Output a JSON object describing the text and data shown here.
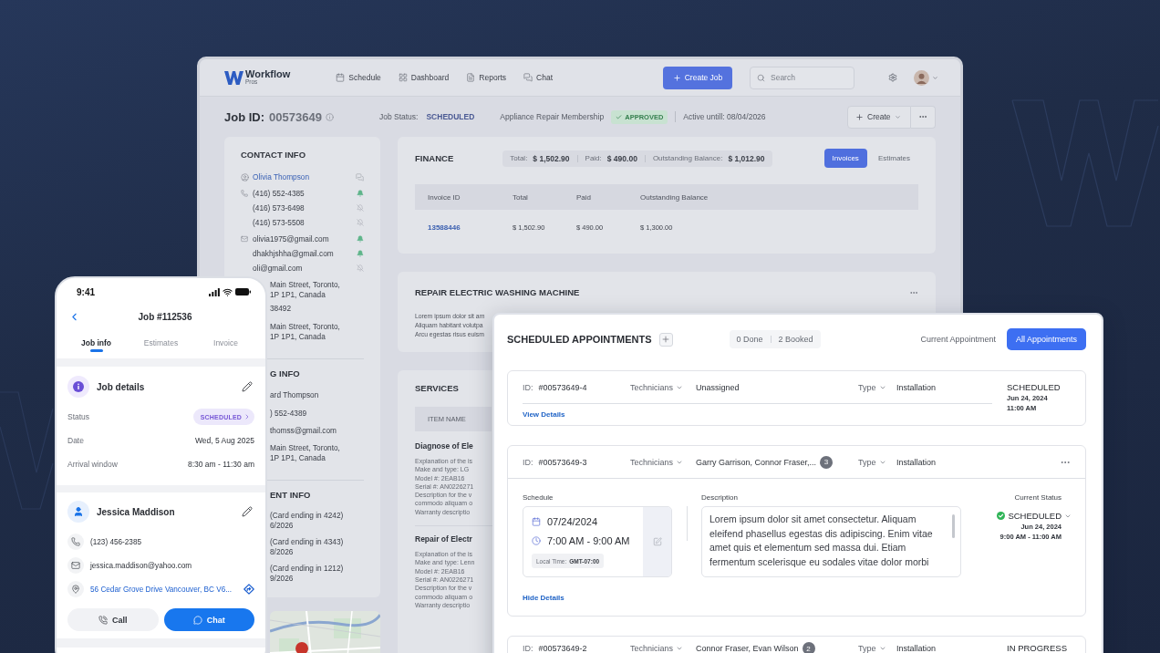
{
  "back_window": {
    "header": {
      "logo": {
        "name": "Workflow",
        "tagline": "Pros"
      },
      "nav": [
        {
          "label": "Schedule"
        },
        {
          "label": "Dashboard"
        },
        {
          "label": "Reports"
        },
        {
          "label": "Chat"
        }
      ],
      "create_button": "Create Job",
      "search": {
        "placeholder": "Search"
      }
    },
    "job_bar": {
      "id_label": "Job ID:",
      "id": "00573649",
      "status_label": "Job Status:",
      "status": "SCHEDULED",
      "membership": "Appliance Repair Membership",
      "badge": "APPROVED",
      "active_until": "Active untill: 08/04/2026",
      "create_menu": "Create"
    },
    "contact_info": {
      "title": "CONTACT INFO",
      "name": "Olivia Thompson",
      "phones": [
        {
          "value": "(416) 552-4385",
          "notify": true
        },
        {
          "value": "(416) 573-6498",
          "notify": false
        },
        {
          "value": "(416) 573-5508",
          "notify": false
        }
      ],
      "emails": [
        {
          "value": "olivia1975@gmail.com",
          "notify": true
        },
        {
          "value": "dhakhjshha@gmail.com",
          "notify": true
        },
        {
          "value": "oli@gmail.com",
          "notify": false
        }
      ],
      "partly_covered": [
        [
          "Main Street, Toronto,",
          "1P 1P1, Canada"
        ],
        [
          "38492"
        ],
        [
          "Main Street, Toronto,",
          "1P 1P1, Canada"
        ]
      ]
    },
    "billing_info": {
      "title": "G INFO",
      "partly_covered": [
        [
          "ard Thompson"
        ],
        [
          ") 552-4389"
        ],
        [
          "thomss@gmail.com"
        ],
        [
          "Main Street, Toronto,",
          "1P 1P1, Canada"
        ]
      ]
    },
    "payment_info": {
      "title": "ENT INFO",
      "partly_covered": [
        [
          "(Card ending in 4242)",
          "6/2026"
        ],
        [
          "(Card ending in 4343)",
          "8/2026"
        ],
        [
          "(Card ending in 1212)",
          "9/2026"
        ]
      ]
    },
    "finance": {
      "title": "FINANCE",
      "summary": [
        {
          "label": "Total:",
          "value": "$ 1,502.90"
        },
        {
          "label": "Paid:",
          "value": "$ 490.00"
        },
        {
          "label": "Outstanding Balance:",
          "value": "$ 1,012.90"
        }
      ],
      "tabs": [
        {
          "label": "Invoices",
          "selected": true
        },
        {
          "label": "Estimates",
          "selected": false
        }
      ],
      "table": {
        "columns": [
          "Invoice ID",
          "Total",
          "Paid",
          "Outstanding Balance"
        ],
        "rows": [
          [
            "13588446",
            "$ 1,502.90",
            "$ 490.00",
            "$ 1,300.00"
          ]
        ]
      }
    },
    "repair": {
      "title": "REPAIR ELECTRIC WASHING MACHINE",
      "partly_covered": [
        "Lorem ipsum dolor sit am",
        "Aliquam habitant volutpa",
        "Arcu egestas risus euism"
      ]
    },
    "services": {
      "title": "SERVICES",
      "column": "ITEM NAME",
      "items": [
        {
          "title": "Diagnose of Ele",
          "lines": [
            "Explanation of the is",
            "Make and type: LG",
            "Model #: 2EAB16",
            "Serial #: AN0226271",
            "Description for the v",
            "commodo aliquam o",
            "Warranty descriptio"
          ]
        },
        {
          "title": "Repair of Electr",
          "lines": [
            "Explanation of the is",
            "Make and type: Lenn",
            "Model #: 2EAB16",
            "Serial #: AN0226271",
            "Description for the v",
            "commodo aliquam o",
            "Warranty descriptio"
          ]
        }
      ]
    }
  },
  "phone": {
    "time": "9:41",
    "title": "Job #112536",
    "tabs": [
      {
        "label": "Job info",
        "selected": true
      },
      {
        "label": "Estimates",
        "selected": false
      },
      {
        "label": "Invoice",
        "selected": false
      }
    ],
    "job_details": {
      "title": "Job details",
      "fields": [
        {
          "label": "Status",
          "value": "SCHEDULED",
          "kind": "badge"
        },
        {
          "label": "Date",
          "value": "Wed, 5 Aug 2025",
          "kind": "text"
        },
        {
          "label": "Arrival window",
          "value": "8:30 am - 11:30 am",
          "kind": "text"
        }
      ]
    },
    "customer": {
      "name": "Jessica Maddison",
      "contacts": [
        {
          "kind": "phone",
          "value": "(123) 456-2385"
        },
        {
          "kind": "email",
          "value": "jessica.maddison@yahoo.com"
        },
        {
          "kind": "address",
          "value": "56 Cedar Grove Drive Vancouver, BC V6..."
        }
      ]
    },
    "actions": [
      {
        "kind": "call",
        "label": "Call"
      },
      {
        "kind": "chat",
        "label": "Chat"
      }
    ]
  },
  "appointments": {
    "title": "SCHEDULED APPOINTMENTS",
    "counts": [
      "0 Done",
      "2 Booked"
    ],
    "tabs": [
      {
        "label": "Current Appointment",
        "selected": false
      },
      {
        "label": "All Appointments",
        "selected": true
      }
    ],
    "items": [
      {
        "id_label": "ID:",
        "id": "#00573649-4",
        "technicians_label": "Technicians",
        "technicians": "Unassigned",
        "type_label": "Type",
        "type": "Installation",
        "expanded": false,
        "status": "SCHEDULED",
        "date": "Jun 24, 2024",
        "time": "11:00 AM",
        "toggle": "View Details"
      },
      {
        "id_label": "ID:",
        "id": "#00573649-3",
        "technicians_label": "Technicians",
        "technicians": "Garry Garrison, Connor Fraser,...",
        "extra_count": "3",
        "type_label": "Type",
        "type": "Installation",
        "expanded": true,
        "details": {
          "schedule_label": "Schedule",
          "date": "07/24/2024",
          "time": "7:00 AM - 9:00 AM",
          "local_time_label": "Local Time:",
          "local_time": "GMT-07:00",
          "description_label": "Description",
          "description": "Lorem ipsum dolor sit amet consectetur. Aliquam eleifend phasellus egestas dis adipiscing. Enim vitae amet quis et elementum sed massa dui. Etiam fermentum scelerisque eu sodales vitae dolor morbi",
          "status_label": "Current Status",
          "status": "SCHEDULED",
          "status_date": "Jun 24, 2024",
          "status_time": "9:00 AM - 11:00 AM"
        },
        "toggle": "Hide Details"
      },
      {
        "id_label": "ID:",
        "id": "#00573649-2",
        "technicians_label": "Technicians",
        "technicians": "Connor Fraser, Evan Wilson",
        "extra_count": "2",
        "type_label": "Type",
        "type": "Installation",
        "expanded": false,
        "status": "IN PROGRESS"
      }
    ]
  }
}
